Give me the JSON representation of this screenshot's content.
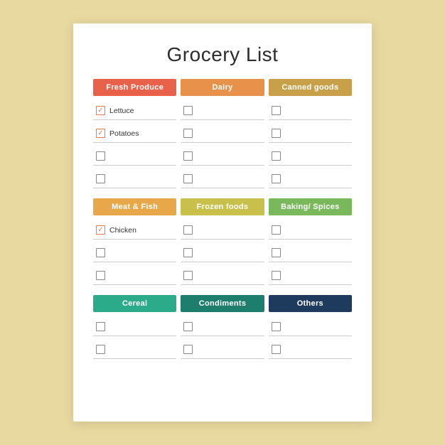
{
  "title": "Grocery List",
  "sections": [
    {
      "id": "section1",
      "headers": [
        {
          "label": "Fresh Produce",
          "color": "#e8614a"
        },
        {
          "label": "Dairy",
          "color": "#e8914a"
        },
        {
          "label": "Canned goods",
          "color": "#c9a04a"
        }
      ],
      "rows": [
        [
          {
            "checked": true,
            "label": "Lettuce"
          },
          {
            "checked": false,
            "label": ""
          },
          {
            "checked": false,
            "label": ""
          }
        ],
        [
          {
            "checked": true,
            "label": "Potatoes"
          },
          {
            "checked": false,
            "label": ""
          },
          {
            "checked": false,
            "label": ""
          }
        ],
        [
          {
            "checked": false,
            "label": ""
          },
          {
            "checked": false,
            "label": ""
          },
          {
            "checked": false,
            "label": ""
          }
        ],
        [
          {
            "checked": false,
            "label": ""
          },
          {
            "checked": false,
            "label": ""
          },
          {
            "checked": false,
            "label": ""
          }
        ]
      ]
    },
    {
      "id": "section2",
      "headers": [
        {
          "label": "Meat & Fish",
          "color": "#e8a84a"
        },
        {
          "label": "Frozen foods",
          "color": "#c8c04a"
        },
        {
          "label": "Baking/ Spices",
          "color": "#7ab85c"
        }
      ],
      "rows": [
        [
          {
            "checked": true,
            "label": "Chicken"
          },
          {
            "checked": false,
            "label": ""
          },
          {
            "checked": false,
            "label": ""
          }
        ],
        [
          {
            "checked": false,
            "label": ""
          },
          {
            "checked": false,
            "label": ""
          },
          {
            "checked": false,
            "label": ""
          }
        ],
        [
          {
            "checked": false,
            "label": ""
          },
          {
            "checked": false,
            "label": ""
          },
          {
            "checked": false,
            "label": ""
          }
        ]
      ]
    },
    {
      "id": "section3",
      "headers": [
        {
          "label": "Cereal",
          "color": "#2bab8a"
        },
        {
          "label": "Condiments",
          "color": "#1e7e6e"
        },
        {
          "label": "Others",
          "color": "#1e3a5c"
        }
      ],
      "rows": [
        [
          {
            "checked": false,
            "label": ""
          },
          {
            "checked": false,
            "label": ""
          },
          {
            "checked": false,
            "label": ""
          }
        ],
        [
          {
            "checked": false,
            "label": ""
          },
          {
            "checked": false,
            "label": ""
          },
          {
            "checked": false,
            "label": ""
          }
        ]
      ]
    }
  ],
  "checkmark": "✓"
}
